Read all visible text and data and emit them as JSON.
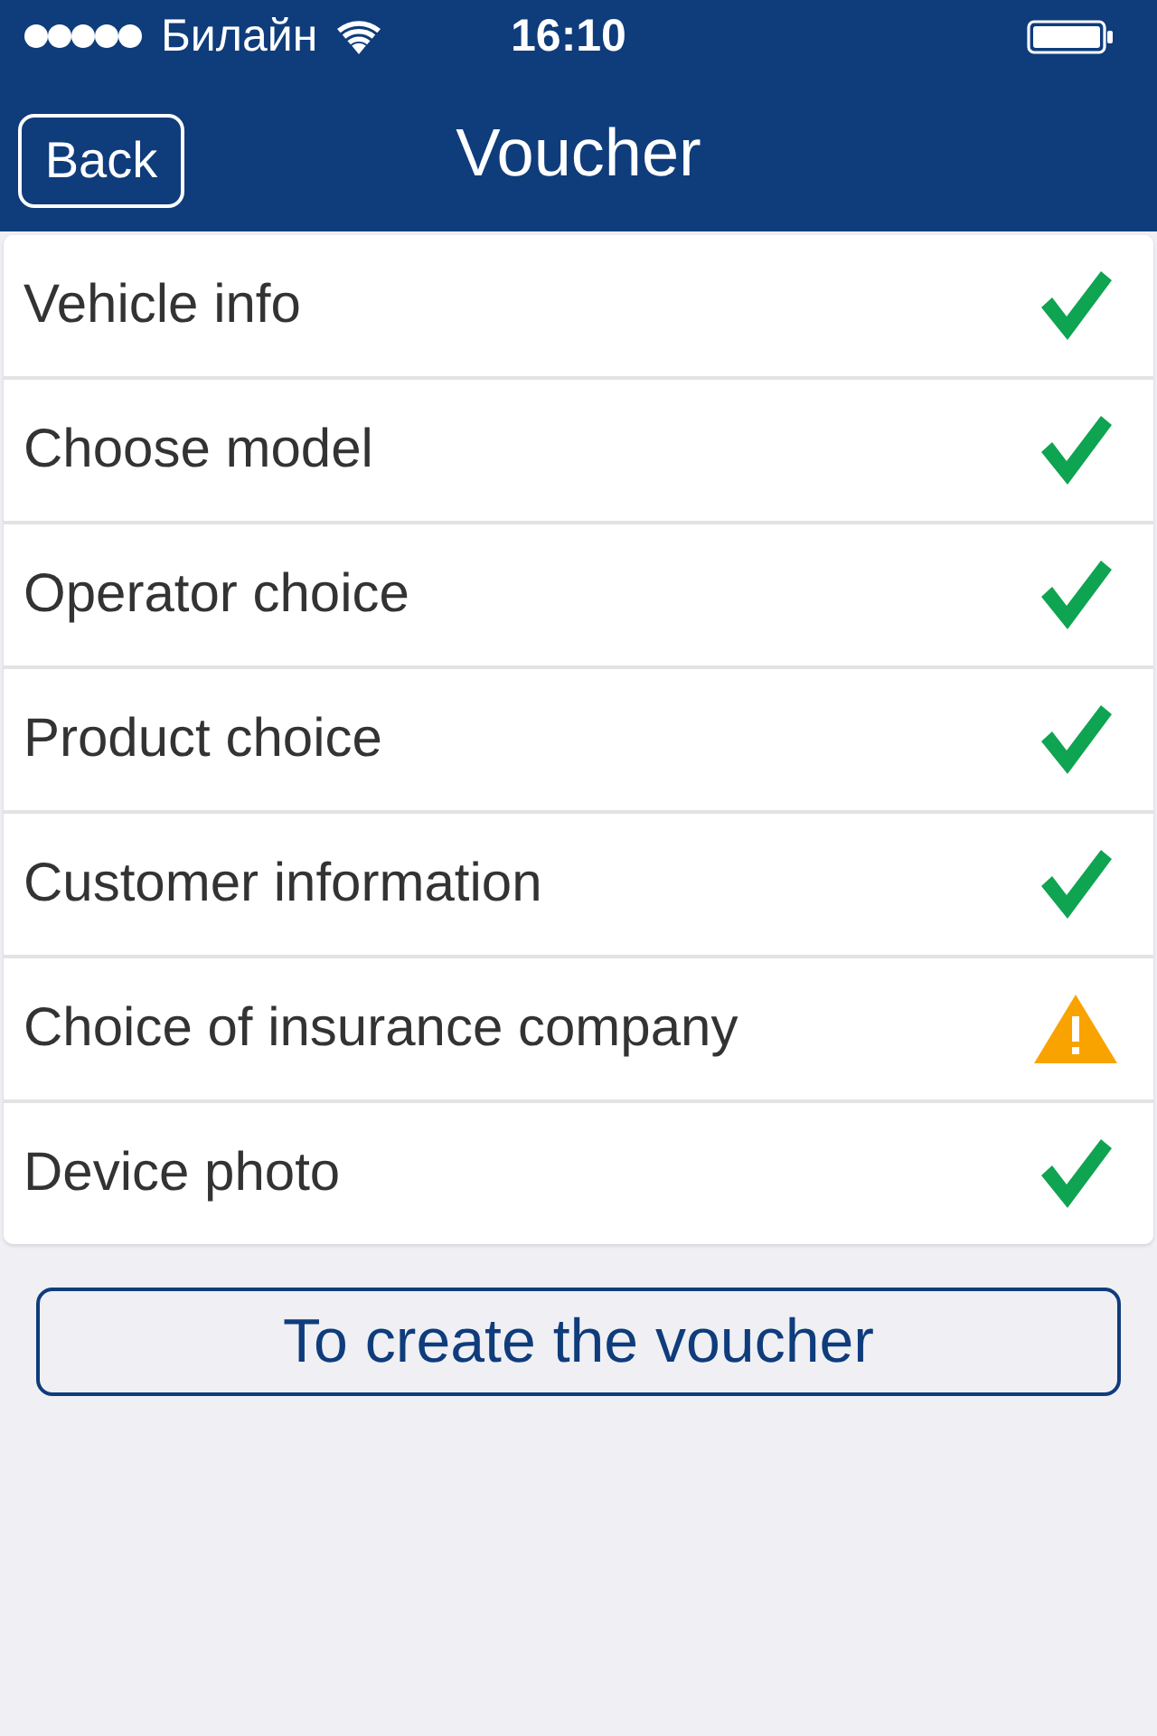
{
  "status_bar": {
    "carrier": "Билайн",
    "time": "16:10"
  },
  "nav_bar": {
    "back_button": "Back",
    "title": "Voucher"
  },
  "steps": [
    {
      "label": "Vehicle info",
      "complete": true
    },
    {
      "label": "Choose model",
      "complete": true
    },
    {
      "label": "Operator choice",
      "complete": true
    },
    {
      "label": "Product choice",
      "complete": true
    },
    {
      "label": "Customer information",
      "complete": true
    },
    {
      "label": "Choice of insurance company",
      "complete": false
    },
    {
      "label": "Device photo",
      "complete": true
    }
  ],
  "create_button": "To create the voucher"
}
